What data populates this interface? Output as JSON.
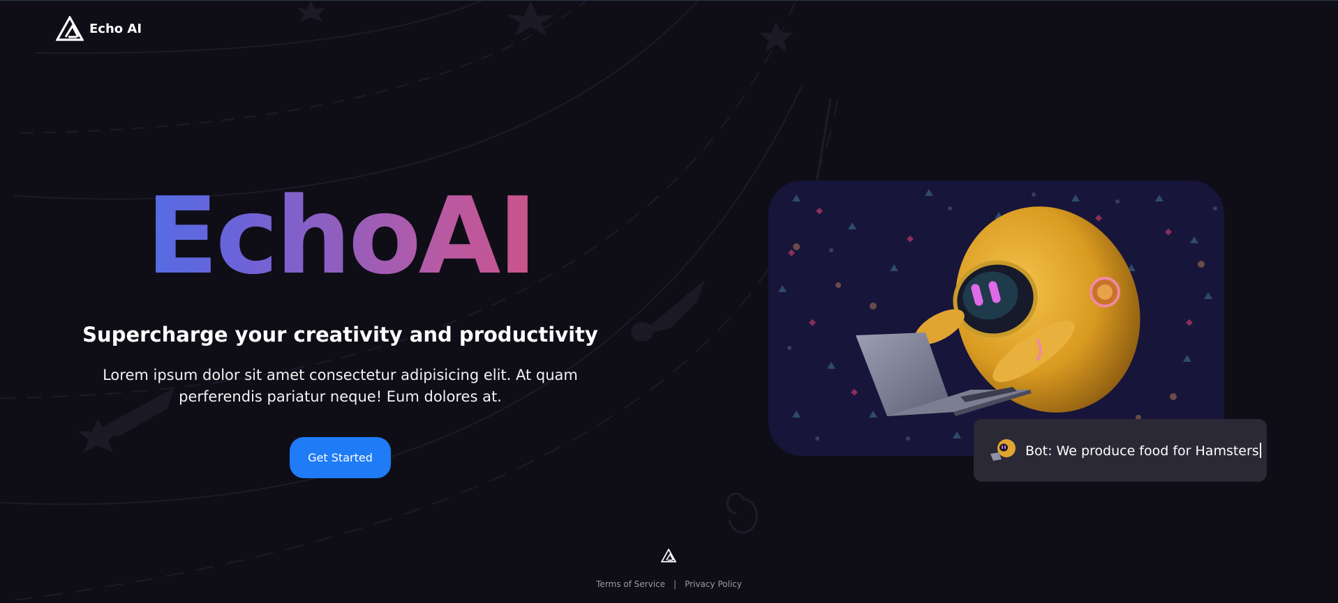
{
  "header": {
    "brand_name": "Echo AI"
  },
  "hero": {
    "title": "EchoAI",
    "tagline": "Supercharge your creativity and productivity",
    "description": "Lorem ipsum dolor sit amet consectetur adipisicing elit. At quam perferendis pariatur neque! Eum dolores at.",
    "cta_label": "Get Started"
  },
  "chat": {
    "message": "Bot: We produce food for Hamsters"
  },
  "footer": {
    "terms_label": "Terms of Service",
    "separator": "|",
    "privacy_label": "Privacy Policy"
  },
  "colors": {
    "background": "#0f0e17",
    "accent_blue": "#1f7bf6",
    "gradient_start": "#2d7bf4",
    "gradient_mid": "#b95aa3",
    "gradient_end": "#e3475f",
    "card_background": "#17153a",
    "chat_background": "#2a2935"
  },
  "icons": {
    "brand_logo": "triangle-logo-icon",
    "chat_avatar": "robot-avatar-icon",
    "footer_logo": "triangle-logo-icon"
  }
}
